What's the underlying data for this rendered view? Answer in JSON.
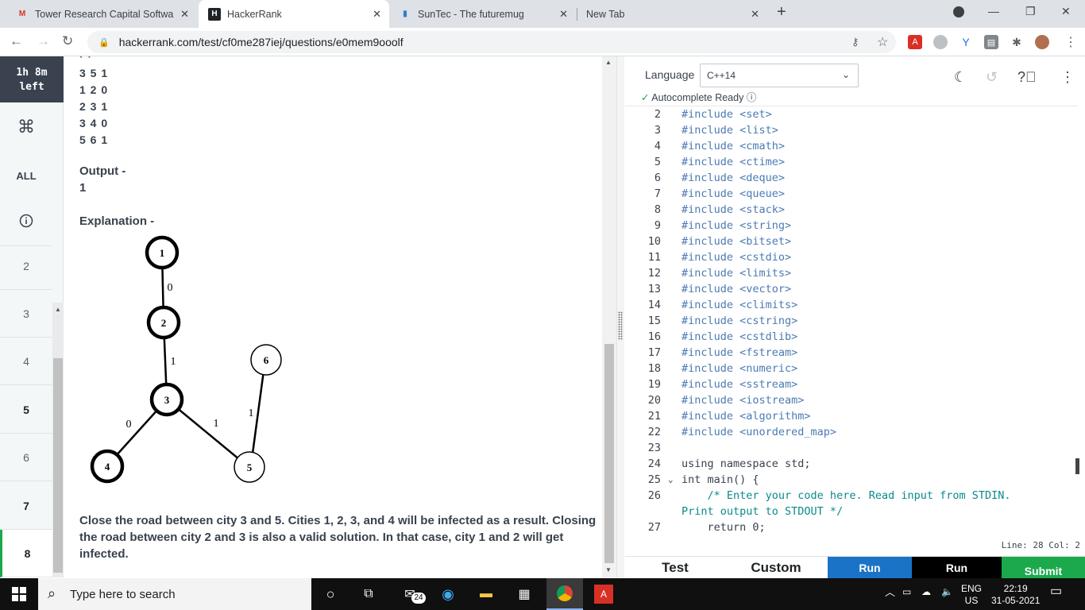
{
  "browser": {
    "tabs": [
      {
        "title": "Tower Research Capital Software",
        "favicon": "gmail-icon"
      },
      {
        "title": "HackerRank",
        "favicon": "hackerrank-icon"
      },
      {
        "title": "SunTec - The futuremug",
        "favicon": "suntec-icon"
      },
      {
        "title": "New Tab",
        "favicon": ""
      }
    ],
    "url": "hackerrank.com/test/cf0me287iej/questions/e0mem9ooolf"
  },
  "sidebar": {
    "timer_line1": "1h 8m",
    "timer_line2": "left",
    "all_label": "ALL",
    "questions": [
      "2",
      "3",
      "4",
      "5",
      "6",
      "7",
      "8"
    ]
  },
  "problem": {
    "input_lines": [
      "3 5 1",
      "1 2 0",
      "2 3 1",
      "3 4 0",
      "5 6 1"
    ],
    "output_title": "Output -",
    "output_value": "1",
    "explanation_title": "Explanation -",
    "graph": {
      "nodes": [
        "1",
        "2",
        "3",
        "4",
        "5",
        "6"
      ],
      "edge_labels": [
        "0",
        "1",
        "0",
        "1",
        "1"
      ]
    },
    "explanation_text": "Close the road between city 3 and 5.  Cities 1, 2, 3, and 4 will be infected as a result. Closing the road between city 2 and 3 is also a valid solution. In that case, city 1 and 2 will get infected."
  },
  "editor": {
    "language_label": "Language",
    "language_value": "C++14",
    "autocomplete": "Autocomplete Ready",
    "lines": [
      {
        "n": "2",
        "code": "#include <set>"
      },
      {
        "n": "3",
        "code": "#include <list>"
      },
      {
        "n": "4",
        "code": "#include <cmath>"
      },
      {
        "n": "5",
        "code": "#include <ctime>"
      },
      {
        "n": "6",
        "code": "#include <deque>"
      },
      {
        "n": "7",
        "code": "#include <queue>"
      },
      {
        "n": "8",
        "code": "#include <stack>"
      },
      {
        "n": "9",
        "code": "#include <string>"
      },
      {
        "n": "10",
        "code": "#include <bitset>"
      },
      {
        "n": "11",
        "code": "#include <cstdio>"
      },
      {
        "n": "12",
        "code": "#include <limits>"
      },
      {
        "n": "13",
        "code": "#include <vector>"
      },
      {
        "n": "14",
        "code": "#include <climits>"
      },
      {
        "n": "15",
        "code": "#include <cstring>"
      },
      {
        "n": "16",
        "code": "#include <cstdlib>"
      },
      {
        "n": "17",
        "code": "#include <fstream>"
      },
      {
        "n": "18",
        "code": "#include <numeric>"
      },
      {
        "n": "19",
        "code": "#include <sstream>"
      },
      {
        "n": "20",
        "code": "#include <iostream>"
      },
      {
        "n": "21",
        "code": "#include <algorithm>"
      },
      {
        "n": "22",
        "code": "#include <unordered_map>"
      },
      {
        "n": "23",
        "code": ""
      },
      {
        "n": "24",
        "code": "using namespace std;"
      },
      {
        "n": "25",
        "code": "int main() {"
      },
      {
        "n": "26",
        "code": "    /* Enter your code here. Read input from STDIN."
      },
      {
        "n": "",
        "code": "Print output to STDOUT */"
      },
      {
        "n": "27",
        "code": "    return 0;"
      }
    ],
    "status": "Line: 28 Col: 2",
    "buttons": {
      "test": "Test",
      "custom": "Custom",
      "run1": "Run",
      "run2": "Run",
      "submit": "Submit"
    }
  },
  "taskbar": {
    "search_placeholder": "Type here to search",
    "mail_badge": "24",
    "lang": "ENG",
    "region": "US",
    "time": "22:19",
    "date": "31-05-2021"
  }
}
